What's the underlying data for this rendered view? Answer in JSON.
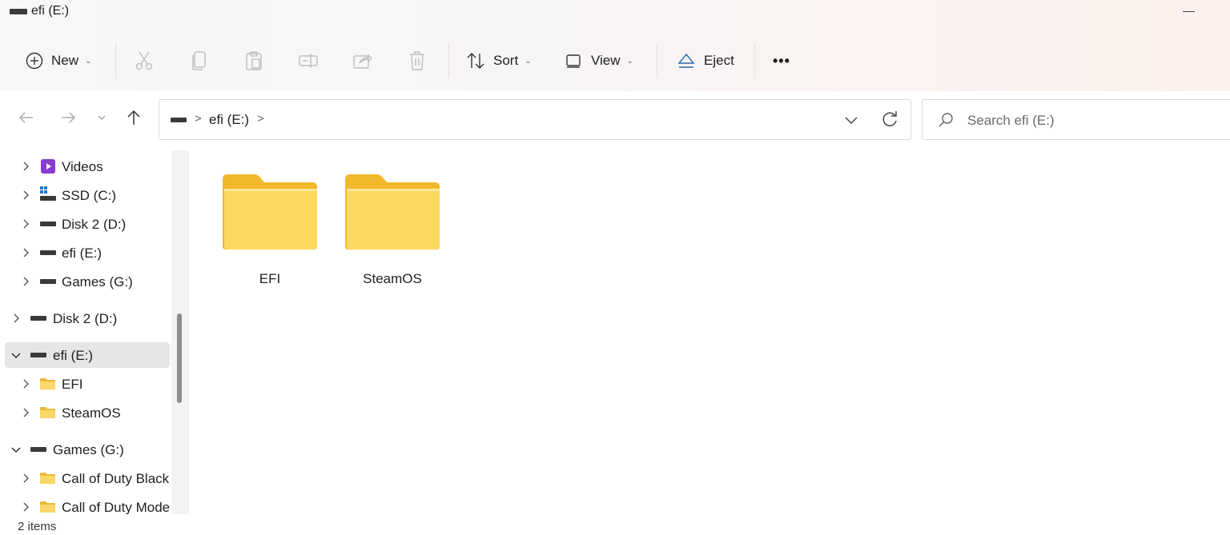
{
  "window": {
    "title": "efi (E:)"
  },
  "toolbar": {
    "new_label": "New",
    "sort_label": "Sort",
    "view_label": "View",
    "eject_label": "Eject",
    "more_label": "•••"
  },
  "address": {
    "crumbs": [
      "efi (E:)"
    ],
    "separator": ">"
  },
  "search": {
    "placeholder": "Search efi (E:)"
  },
  "nav": {
    "items": [
      {
        "label": "Videos"
      },
      {
        "label": "SSD (C:)"
      },
      {
        "label": "Disk 2 (D:)"
      },
      {
        "label": "efi (E:)"
      },
      {
        "label": "Games (G:)"
      },
      {
        "label": "Disk 2 (D:)"
      },
      {
        "label": "efi (E:)"
      },
      {
        "label": "EFI"
      },
      {
        "label": "SteamOS"
      },
      {
        "label": "Games (G:)"
      },
      {
        "label": "Call of Duty Black"
      },
      {
        "label": "Call of Duty Mode"
      }
    ]
  },
  "content": {
    "folders": [
      {
        "name": "EFI"
      },
      {
        "name": "SteamOS"
      }
    ]
  },
  "status": {
    "text": "2 items"
  },
  "colors": {
    "folder_yellow": "#f7cf4a",
    "folder_light": "#fde28a",
    "selected_bg": "#e6e6e6",
    "eject_blue": "#2b6cb0",
    "video_purple": "#8a3bd1"
  }
}
